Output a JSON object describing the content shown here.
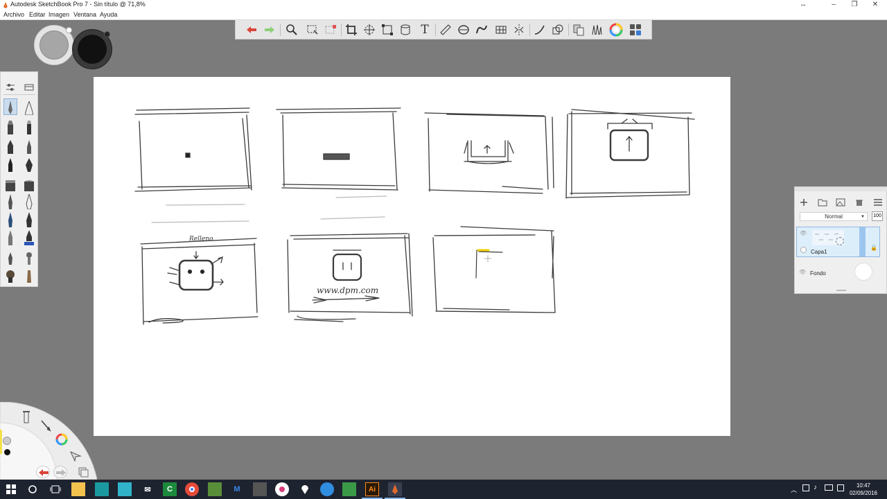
{
  "window": {
    "title": "Autodesk SketchBook Pro 7 - Sin título @ 71,8%",
    "controls": [
      "↔",
      "–",
      "❐",
      "✕"
    ]
  },
  "menu": [
    "Archivo",
    "Editar",
    "Imagen",
    "Ventana",
    "Ayuda"
  ],
  "toolbar": {
    "tools": [
      "undo-icon",
      "redo-icon",
      "zoom-icon",
      "select-icon",
      "select-region-icon",
      "crop-icon",
      "transform-icon",
      "distort-icon",
      "cylinder-icon",
      "text-icon",
      "ruler-icon",
      "ellipse-guide-icon",
      "french-curve-icon",
      "perspective-icon",
      "symmetry-icon",
      "curve-icon",
      "shapes-icon",
      "copy-paste-icon",
      "brush-library-icon",
      "color-wheel-icon",
      "tool-grid-icon"
    ],
    "text_tool_label": "T"
  },
  "colors": {
    "puck_primary": "#a6a6a6",
    "puck_secondary": "#111111",
    "undo": "#d9443a",
    "redo": "#8ed07a",
    "selected_layer": "#ddeefb"
  },
  "layers": {
    "blend_mode": "Normal",
    "opacity": "100",
    "items": [
      {
        "name": "Capa1",
        "selected": true
      },
      {
        "name": "Fondo",
        "selected": false
      }
    ]
  },
  "canvas": {
    "sketch_labels": [
      "Relleno",
      "www.dpm.com"
    ]
  },
  "taskbar": {
    "apps": [
      "start-icon",
      "search-icon",
      "task-view-icon",
      "file-explorer-icon",
      "app-icon",
      "mindmap-icon",
      "email-icon",
      "camtasia-icon",
      "chrome-icon",
      "mail-icon",
      "malwarebytes-icon",
      "media-player-icon",
      "itunes-icon",
      "maps-icon",
      "photos-icon",
      "excel-icon",
      "illustrator-icon",
      "sketchbook-icon"
    ],
    "camtasia_label": "C",
    "malwarebytes_label": "M",
    "illustrator_label": "Ai",
    "time": "10:47",
    "date": "02/09/2016"
  }
}
